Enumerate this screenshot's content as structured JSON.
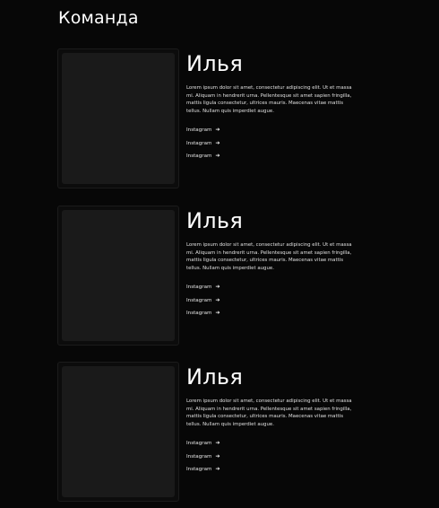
{
  "page": {
    "title": "Команда"
  },
  "members": [
    {
      "name": "Илья",
      "description": "Lorem ipsum dolor sit amet, consectetur adipiscing elit. Ut et massa mi. Aliquam in hendrerit urna. Pellentesque sit amet sapien fringilla, mattis ligula consectetur, ultrices mauris. Maecenas vitae mattis tellus. Nullam quis imperdiet augue.",
      "links": [
        {
          "label": "Instagram",
          "icon": "arrow-right-icon"
        },
        {
          "label": "Instagram",
          "icon": "arrow-right-icon"
        },
        {
          "label": "Instagram",
          "icon": "arrow-right-icon"
        }
      ]
    },
    {
      "name": "Илья",
      "description": "Lorem ipsum dolor sit amet, consectetur adipiscing elit. Ut et massa mi. Aliquam in hendrerit urna. Pellentesque sit amet sapien fringilla, mattis ligula consectetur, ultrices mauris. Maecenas vitae mattis tellus. Nullam quis imperdiet augue.",
      "links": [
        {
          "label": "Instagram",
          "icon": "arrow-right-icon"
        },
        {
          "label": "Instagram",
          "icon": "arrow-right-icon"
        },
        {
          "label": "Instagram",
          "icon": "arrow-right-icon"
        }
      ]
    },
    {
      "name": "Илья",
      "description": "Lorem ipsum dolor sit amet, consectetur adipiscing elit. Ut et massa mi. Aliquam in hendrerit urna. Pellentesque sit amet sapien fringilla, mattis ligula consectetur, ultrices mauris. Maecenas vitae mattis tellus. Nullam quis imperdiet augue.",
      "links": [
        {
          "label": "Instagram",
          "icon": "arrow-right-icon"
        },
        {
          "label": "Instagram",
          "icon": "arrow-right-icon"
        },
        {
          "label": "Instagram",
          "icon": "arrow-right-icon"
        }
      ]
    }
  ],
  "colors": {
    "background": "#070707",
    "photo_placeholder": "#1a1a1a",
    "text": "#ffffff"
  }
}
